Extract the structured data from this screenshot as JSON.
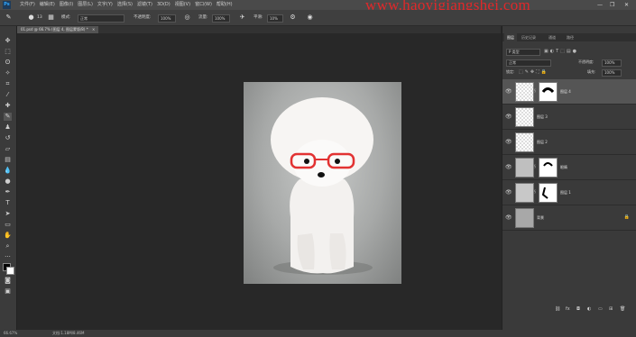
{
  "app": {
    "logo": "Ps"
  },
  "menu": [
    "文件(F)",
    "编辑(E)",
    "图像(I)",
    "图层(L)",
    "文字(Y)",
    "选择(S)",
    "滤镜(T)",
    "3D(D)",
    "视图(V)",
    "窗口(W)",
    "帮助(H)"
  ],
  "watermark": "www.haoyigiangshei.com",
  "window_controls": {
    "minimize": "—",
    "restore": "❐",
    "close": "✕"
  },
  "options": {
    "brush_size": "13",
    "mode_label": "模式:",
    "mode_value": "正常",
    "opacity_label": "不透明度:",
    "opacity_value": "100%",
    "flow_label": "流量:",
    "flow_value": "100%",
    "smooth_label": "平滑:",
    "smooth_value": "10%"
  },
  "document": {
    "tab_label": "01.psd @ 66.7% (图层 4, 图层蒙版/8) *",
    "close": "×"
  },
  "status": {
    "zoom": "66.67%",
    "doc_size": "文档:1.18M/8.46M"
  },
  "panel": {
    "tabs": [
      "图层",
      "历史记录",
      "通道",
      "路径"
    ],
    "filter_label": "P 类型",
    "blend_mode": "正常",
    "opacity_label": "不透明度:",
    "opacity_value": "100%",
    "lock_label": "锁定:",
    "fill_label": "填充:",
    "fill_value": "100%",
    "layers": [
      {
        "name": "图层 4",
        "selected": true,
        "has_mask": true
      },
      {
        "name": "图层 3",
        "selected": false,
        "has_mask": false
      },
      {
        "name": "图层 2",
        "selected": false,
        "has_mask": false
      },
      {
        "name": "眼睛",
        "selected": false,
        "has_mask": true
      },
      {
        "name": "图层 1",
        "selected": false,
        "has_mask": true
      },
      {
        "name": "背景",
        "selected": false,
        "has_mask": false,
        "locked": true
      }
    ],
    "bottom_icons": [
      "link-icon",
      "fx-icon",
      "mask-icon",
      "adjustment-icon",
      "folder-icon",
      "new-layer-icon",
      "trash-icon"
    ]
  },
  "tools": [
    "move-icon",
    "marquee-icon",
    "lasso-icon",
    "quick-select-icon",
    "crop-icon",
    "eyedropper-icon",
    "healing-icon",
    "brush-icon",
    "stamp-icon",
    "history-brush-icon",
    "eraser-icon",
    "gradient-icon",
    "blur-icon",
    "dodge-icon",
    "pen-icon",
    "type-icon",
    "path-select-icon",
    "shape-icon",
    "hand-icon",
    "zoom-icon",
    "more-tools-icon",
    "color-swatches",
    "quick-mask-icon",
    "screen-mode-icon"
  ]
}
